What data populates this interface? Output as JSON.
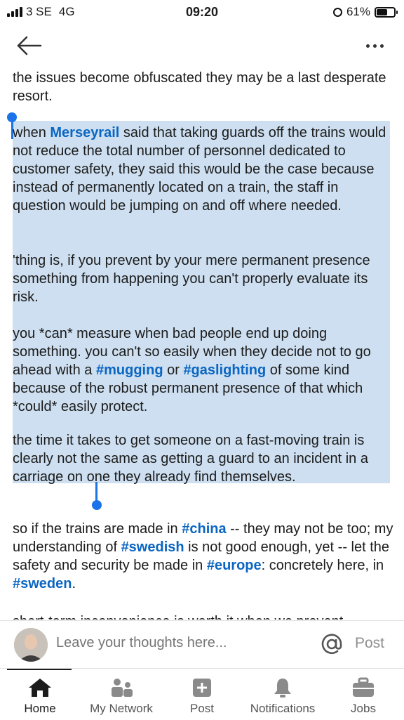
{
  "status": {
    "carrier": "3 SE",
    "network": "4G",
    "time": "09:20",
    "battery": "61%",
    "battery_level": 0.61
  },
  "nav": {
    "back_icon": "arrow-left-icon",
    "more_icon": "more-horizontal-icon"
  },
  "article": {
    "p0": "the issues become obfuscated they may be a last desperate resort.",
    "p1_start": "when ",
    "p1_mention": "Merseyrail",
    "p1_rest": " said that taking guards off the trains would not reduce the total number of personnel dedicated to customer safety, they said this would be the case because instead of permanently located on a train, the staff in question would be jumping on and off where needed.",
    "p2": "'thing is, if you prevent by your mere permanent presence something from happening you can't properly evaluate its risk.",
    "p3_a": "you *can* measure when bad people end up doing something. you can't so easily when they decide not to go ahead with a ",
    "p3_tag1": "#mugging",
    "p3_b": " or ",
    "p3_tag2": "#gaslighting",
    "p3_c": " of some kind because of the robust permanent presence of that which *could* easily protect.",
    "p4": "the time it takes to get someone on a fast-moving train is clearly not the same as getting a guard to an incident in a carriage on one they already find themselves.",
    "p5_a": "so if the trains are made in ",
    "p5_tag1": "#china",
    "p5_b": " -- they may not be too; my understanding of ",
    "p5_tag2": "#swedish",
    "p5_c": " is not good enough, yet -- let the safety and security be made in ",
    "p5_tag3": "#europe",
    "p5_d": ": concretely here, in ",
    "p5_tag4": "#sweden",
    "p5_e": ".",
    "p6_partial": "short-term inconvenience is worth it when we prevent"
  },
  "comment": {
    "placeholder": "Leave your thoughts here...",
    "mention_icon": "at-sign-icon",
    "post_label": "Post"
  },
  "bottom_nav": [
    {
      "label": "Home",
      "icon": "home-icon",
      "active": true
    },
    {
      "label": "My Network",
      "icon": "network-icon"
    },
    {
      "label": "Post",
      "icon": "post-plus-icon"
    },
    {
      "label": "Notifications",
      "icon": "bell-icon"
    },
    {
      "label": "Jobs",
      "icon": "briefcase-icon"
    }
  ],
  "colors": {
    "link": "#0a66c2",
    "selection": "#cddff0",
    "handle": "#1a73e8"
  }
}
